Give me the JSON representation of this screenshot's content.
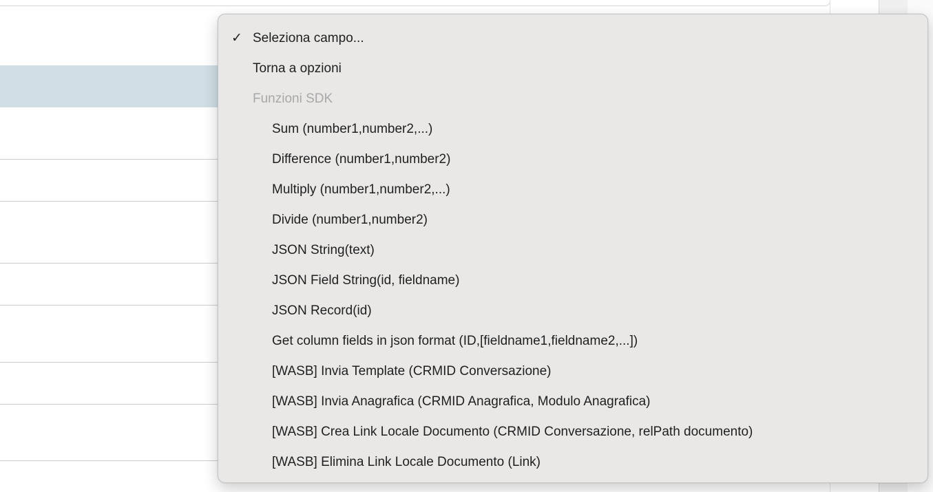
{
  "menu": {
    "items": [
      {
        "label": "Seleziona campo...",
        "checked": true
      },
      {
        "label": "Torna a opzioni"
      },
      {
        "label": "Funzioni SDK",
        "disabled": true
      },
      {
        "label": "Sum (number1,number2,...)"
      },
      {
        "label": "Difference (number1,number2)"
      },
      {
        "label": "Multiply (number1,number2,...)"
      },
      {
        "label": "Divide (number1,number2)"
      },
      {
        "label": "JSON String(text)"
      },
      {
        "label": "JSON Field String(id, fieldname)"
      },
      {
        "label": "JSON Record(id)"
      },
      {
        "label": "Get column fields in json format (ID,[fieldname1,fieldname2,...])"
      },
      {
        "label": "[WASB] Invia Template (CRMID Conversazione)"
      },
      {
        "label": "[WASB] Invia Anagrafica (CRMID Anagrafica, Modulo Anagrafica)"
      },
      {
        "label": "[WASB] Crea Link Locale Documento (CRMID Conversazione, relPath documento)"
      },
      {
        "label": "[WASB] Elimina Link Locale Documento (Link)"
      }
    ],
    "check_glyph": "✓"
  },
  "colors": {
    "selected_row": "#cfdfe5",
    "menu_background": "#e9e8e7",
    "disabled_text": "#a8a8a8"
  }
}
